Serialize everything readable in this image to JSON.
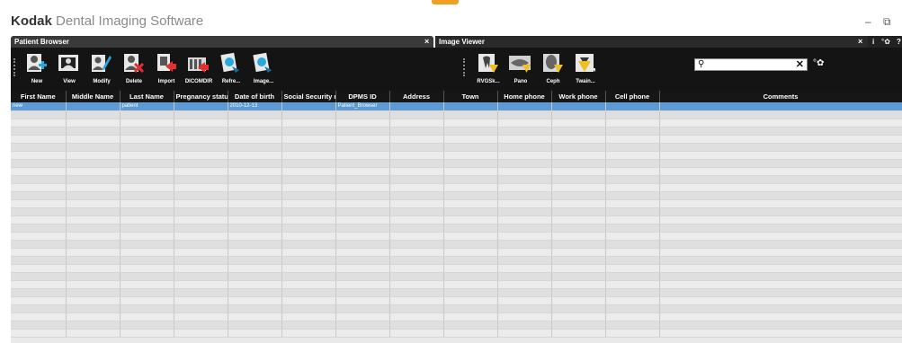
{
  "app": {
    "brand_name": "Kodak",
    "brand_rest": "Dental Imaging Software",
    "minimize": "–",
    "restore": "⧉"
  },
  "panels": {
    "patient_browser": {
      "title": "Patient Browser",
      "close": "×"
    },
    "image_viewer": {
      "title": "Image Viewer",
      "close": "×"
    }
  },
  "system_icons": {
    "info": "i",
    "settings": "°✿",
    "help": "?"
  },
  "toolbar": {
    "left_tools": [
      {
        "label": "New",
        "icon": "new-patient-icon"
      },
      {
        "label": "View",
        "icon": "view-patient-icon"
      },
      {
        "label": "Modify",
        "icon": "modify-patient-icon"
      },
      {
        "label": "Delete",
        "icon": "delete-patient-icon"
      },
      {
        "label": "Import",
        "icon": "import-icon"
      },
      {
        "label": "DICOMDIR",
        "icon": "dicomdir-icon"
      },
      {
        "label": "Refre...",
        "icon": "refresh-icon"
      },
      {
        "label": "Image...",
        "icon": "image-icon"
      }
    ],
    "right_tools": [
      {
        "label": "RVGSk...",
        "icon": "rvg-sensor-icon"
      },
      {
        "label": "Pano",
        "icon": "pano-icon"
      },
      {
        "label": "Ceph",
        "icon": "ceph-icon"
      },
      {
        "label": "Twain...",
        "icon": "twain-icon"
      }
    ],
    "search": {
      "value": "",
      "placeholder": "",
      "clear": "✕"
    },
    "search_settings": "°✿"
  },
  "table": {
    "columns": [
      "First Name",
      "Middle Name",
      "Last Name",
      "Pregnancy status",
      "Date of birth",
      "Social Security numb",
      "DPMS ID",
      "Address",
      "Town",
      "Home phone",
      "Work phone",
      "Cell phone",
      "Comments"
    ],
    "rows": [
      [
        "new",
        "",
        "patient",
        "",
        "2010-12-13",
        "",
        "Patient_Browser",
        "",
        "",
        "",
        "",
        "",
        ""
      ]
    ]
  },
  "colors": {
    "toolbar_bg": "#141414",
    "selection": "#5d9bd6",
    "header_bg": "#161616"
  }
}
